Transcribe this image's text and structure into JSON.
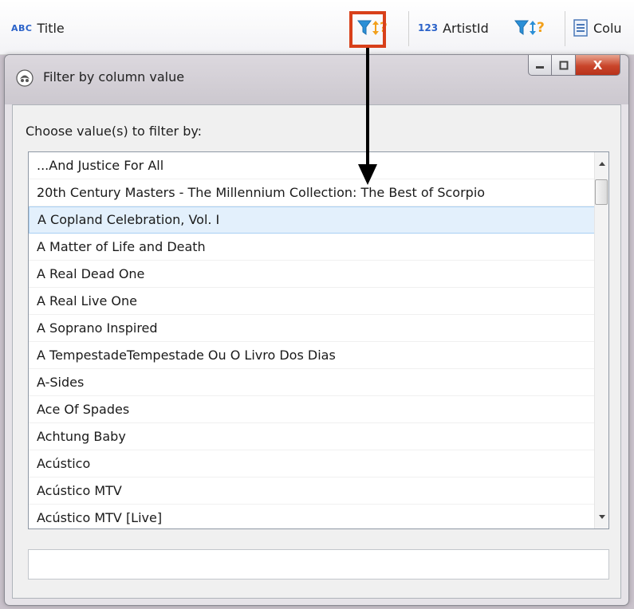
{
  "grid_header": {
    "col1_type": "ABC",
    "col1_title": "Title",
    "col1_filter_help": "?",
    "col2_type": "123",
    "col2_title": "ArtistId",
    "col2_filter_help": "?",
    "col3_title": "Colu",
    "filter_icon": "funnel-sort-icon",
    "highlight_color": "#d8401a"
  },
  "dialog": {
    "title": "Filter by column value",
    "close_label": "X",
    "prompt": "Choose value(s) to filter by:",
    "items": [
      "...And Justice For All",
      "20th Century Masters - The Millennium Collection: The Best of Scorpio",
      "A Copland Celebration, Vol. I",
      "A Matter of Life and Death",
      "A Real Dead One",
      "A Real Live One",
      "A Soprano Inspired",
      "A TempestadeTempestade Ou O Livro Dos Dias",
      "A-Sides",
      "Ace Of Spades",
      "Achtung Baby",
      "Acústico",
      "Acústico MTV",
      "Acústico MTV [Live]"
    ],
    "selected_item": "A Copland Celebration, Vol. I",
    "filter_value": ""
  }
}
